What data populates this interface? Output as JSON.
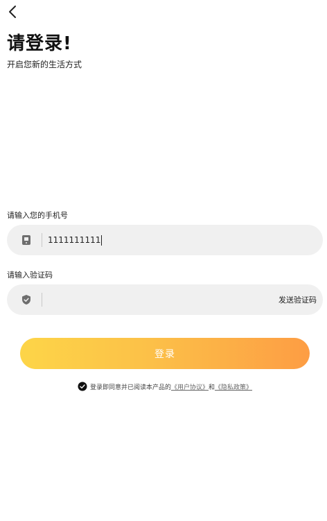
{
  "header": {
    "title": "请登录!",
    "subtitle": "开启您新的生活方式"
  },
  "phone": {
    "label": "请输入您的手机号",
    "value": "1111111111"
  },
  "code": {
    "label": "请输入验证码",
    "value": "",
    "send_label": "发送验证码"
  },
  "login": {
    "label": "登录"
  },
  "agreement": {
    "prefix": "登录即同意并已阅读本产品的",
    "user_agreement": "《用户协议》",
    "and": "和",
    "privacy_policy": "《隐私政策》",
    "checked": true
  },
  "colors": {
    "gradient_start": "#fdd548",
    "gradient_end": "#fd9d44",
    "field_bg": "#f0f0f0"
  }
}
